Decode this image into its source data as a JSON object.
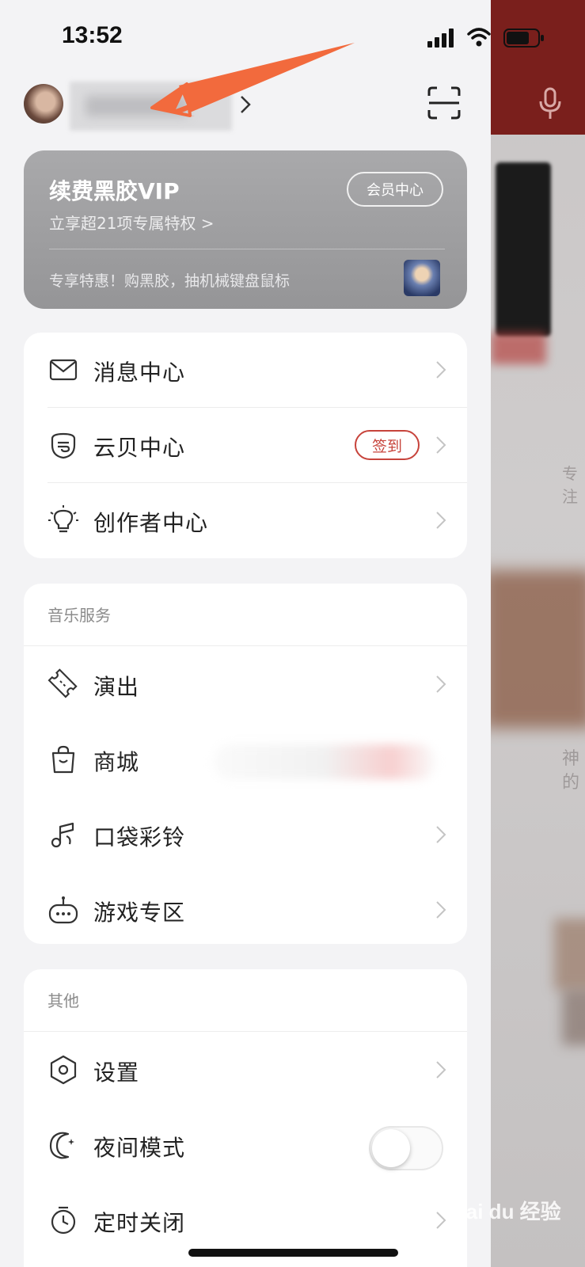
{
  "status_bar": {
    "time": "13:52"
  },
  "profile": {
    "username": "",
    "chevron": "chevron-right-icon",
    "scan_icon": "scan-icon"
  },
  "vip_card": {
    "title": "续费黑胶VIP",
    "subtitle": "立享超21项专属特权 >",
    "button_label": "会员中心",
    "promo": "专享特惠！购黑胶，抽机械键盘鼠标"
  },
  "main_menu": {
    "items": [
      {
        "label": "消息中心",
        "icon": "mail-icon"
      },
      {
        "label": "云贝中心",
        "icon": "cloud-coin-icon",
        "badge": "签到"
      },
      {
        "label": "创作者中心",
        "icon": "lightbulb-icon"
      }
    ]
  },
  "music_services": {
    "title": "音乐服务",
    "items": [
      {
        "label": "演出",
        "icon": "ticket-icon"
      },
      {
        "label": "商城",
        "icon": "shopping-bag-icon"
      },
      {
        "label": "口袋彩铃",
        "icon": "music-note-icon"
      },
      {
        "label": "游戏专区",
        "icon": "gamepad-icon"
      }
    ]
  },
  "others": {
    "title": "其他",
    "items": [
      {
        "label": "设置",
        "icon": "settings-icon"
      },
      {
        "label": "夜间模式",
        "icon": "moon-icon",
        "toggle_on": false
      },
      {
        "label": "定时关闭",
        "icon": "timer-icon"
      }
    ]
  },
  "background": {
    "faint_text_1": "神",
    "faint_text_2": "的",
    "faint_text_3": "专注"
  },
  "watermark": "Bai du 经验",
  "colors": {
    "accent_red": "#c7433b",
    "vip_gray": "#a0a0a2",
    "bg": "#f3f3f5",
    "arrow": "#f26a3d"
  }
}
